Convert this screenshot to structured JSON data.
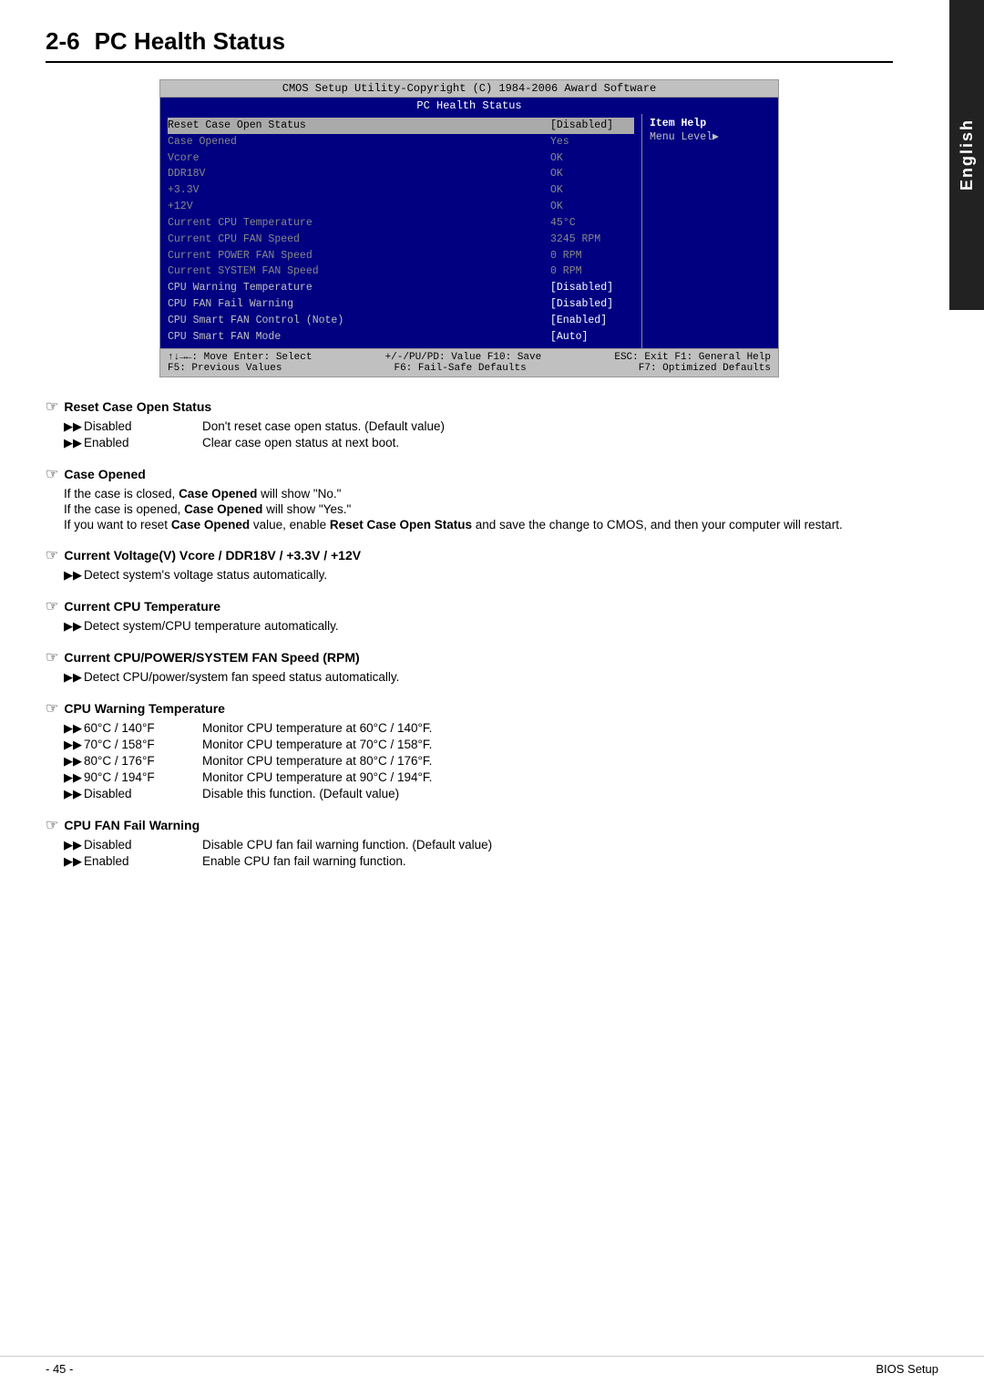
{
  "page": {
    "heading_num": "2-6",
    "heading_title": "PC Health Status",
    "footer_page": "- 45 -",
    "footer_right": "BIOS Setup"
  },
  "english_tab": "English",
  "bios": {
    "title_bar": "CMOS Setup Utility-Copyright (C) 1984-2006 Award Software",
    "subtitle": "PC Health Status",
    "rows": [
      {
        "label": "Reset Case Open Status",
        "value": "[Disabled]",
        "label_style": "white",
        "value_style": "white",
        "selected": true
      },
      {
        "label": "Case Opened",
        "value": "Yes",
        "label_style": "gray",
        "value_style": "gray"
      },
      {
        "label": "Vcore",
        "value": "OK",
        "label_style": "gray",
        "value_style": "gray"
      },
      {
        "label": "DDR18V",
        "value": "OK",
        "label_style": "gray",
        "value_style": "gray"
      },
      {
        "label": "+3.3V",
        "value": "OK",
        "label_style": "gray",
        "value_style": "gray"
      },
      {
        "label": "+12V",
        "value": "OK",
        "label_style": "gray",
        "value_style": "gray"
      },
      {
        "label": "Current CPU Temperature",
        "value": "45°C",
        "label_style": "gray",
        "value_style": "gray"
      },
      {
        "label": "Current CPU FAN Speed",
        "value": "3245 RPM",
        "label_style": "gray",
        "value_style": "gray"
      },
      {
        "label": "Current POWER FAN Speed",
        "value": "0 RPM",
        "label_style": "gray",
        "value_style": "gray"
      },
      {
        "label": "Current SYSTEM FAN Speed",
        "value": "0 RPM",
        "label_style": "gray",
        "value_style": "gray"
      },
      {
        "label": "CPU Warning Temperature",
        "value": "[Disabled]",
        "label_style": "normal",
        "value_style": "white"
      },
      {
        "label": "CPU FAN Fail Warning",
        "value": "[Disabled]",
        "label_style": "normal",
        "value_style": "white"
      },
      {
        "label": "CPU Smart FAN Control (Note)",
        "value": "[Enabled]",
        "label_style": "normal",
        "value_style": "white"
      },
      {
        "label": "CPU Smart FAN Mode",
        "value": "[Auto]",
        "label_style": "normal",
        "value_style": "white"
      }
    ],
    "help": {
      "title": "Item Help",
      "text": "Menu Level▶"
    },
    "footer": [
      {
        "left": "↑↓→←: Move    Enter: Select",
        "mid": "+/-/PU/PD: Value    F10: Save",
        "right": "ESC: Exit     F1: General Help"
      },
      {
        "left": "F5: Previous Values",
        "mid": "F6: Fail-Safe Defaults",
        "right": "F7: Optimized Defaults"
      }
    ]
  },
  "sections": [
    {
      "id": "reset-case-open-status",
      "title": "Reset Case Open Status",
      "bullets": [
        {
          "label": "Disabled",
          "desc": "Don't reset case open status. (Default value)"
        },
        {
          "label": "Enabled",
          "desc": "Clear case open status at next boot."
        }
      ],
      "paras": []
    },
    {
      "id": "case-opened",
      "title": "Case Opened",
      "bullets": [],
      "paras": [
        "If the case is closed, <b>Case Opened</b> will show \"No.\"",
        "If the case is opened, <b>Case Opened</b> will show \"Yes.\"",
        "If you want to reset <b>Case Opened</b> value, enable <b>Reset Case Open Status</b> and save the change to CMOS, and then your computer will restart."
      ]
    },
    {
      "id": "current-voltage",
      "title": "Current Voltage(V) Vcore / DDR18V / +3.3V / +12V",
      "bullets": [
        {
          "label": "",
          "desc": "Detect system's voltage status automatically."
        }
      ],
      "paras": []
    },
    {
      "id": "current-cpu-temperature",
      "title": "Current CPU Temperature",
      "bullets": [
        {
          "label": "",
          "desc": "Detect system/CPU temperature automatically."
        }
      ],
      "paras": []
    },
    {
      "id": "current-cpu-fan-speed",
      "title": "Current CPU/POWER/SYSTEM FAN Speed (RPM)",
      "bullets": [
        {
          "label": "",
          "desc": "Detect CPU/power/system fan speed status automatically."
        }
      ],
      "paras": []
    },
    {
      "id": "cpu-warning-temperature",
      "title": "CPU Warning Temperature",
      "bullets": [
        {
          "label": "60°C / 140°F",
          "desc": "Monitor CPU temperature at 60°C / 140°F."
        },
        {
          "label": "70°C / 158°F",
          "desc": "Monitor CPU temperature at 70°C / 158°F."
        },
        {
          "label": "80°C / 176°F",
          "desc": "Monitor CPU temperature at 80°C / 176°F."
        },
        {
          "label": "90°C / 194°F",
          "desc": "Monitor CPU temperature at 90°C / 194°F."
        },
        {
          "label": "Disabled",
          "desc": "Disable this function. (Default value)"
        }
      ],
      "paras": []
    },
    {
      "id": "cpu-fan-fail-warning",
      "title": "CPU FAN Fail Warning",
      "bullets": [
        {
          "label": "Disabled",
          "desc": "Disable CPU fan fail warning function. (Default value)"
        },
        {
          "label": "Enabled",
          "desc": "Enable CPU fan fail warning function."
        }
      ],
      "paras": []
    }
  ]
}
